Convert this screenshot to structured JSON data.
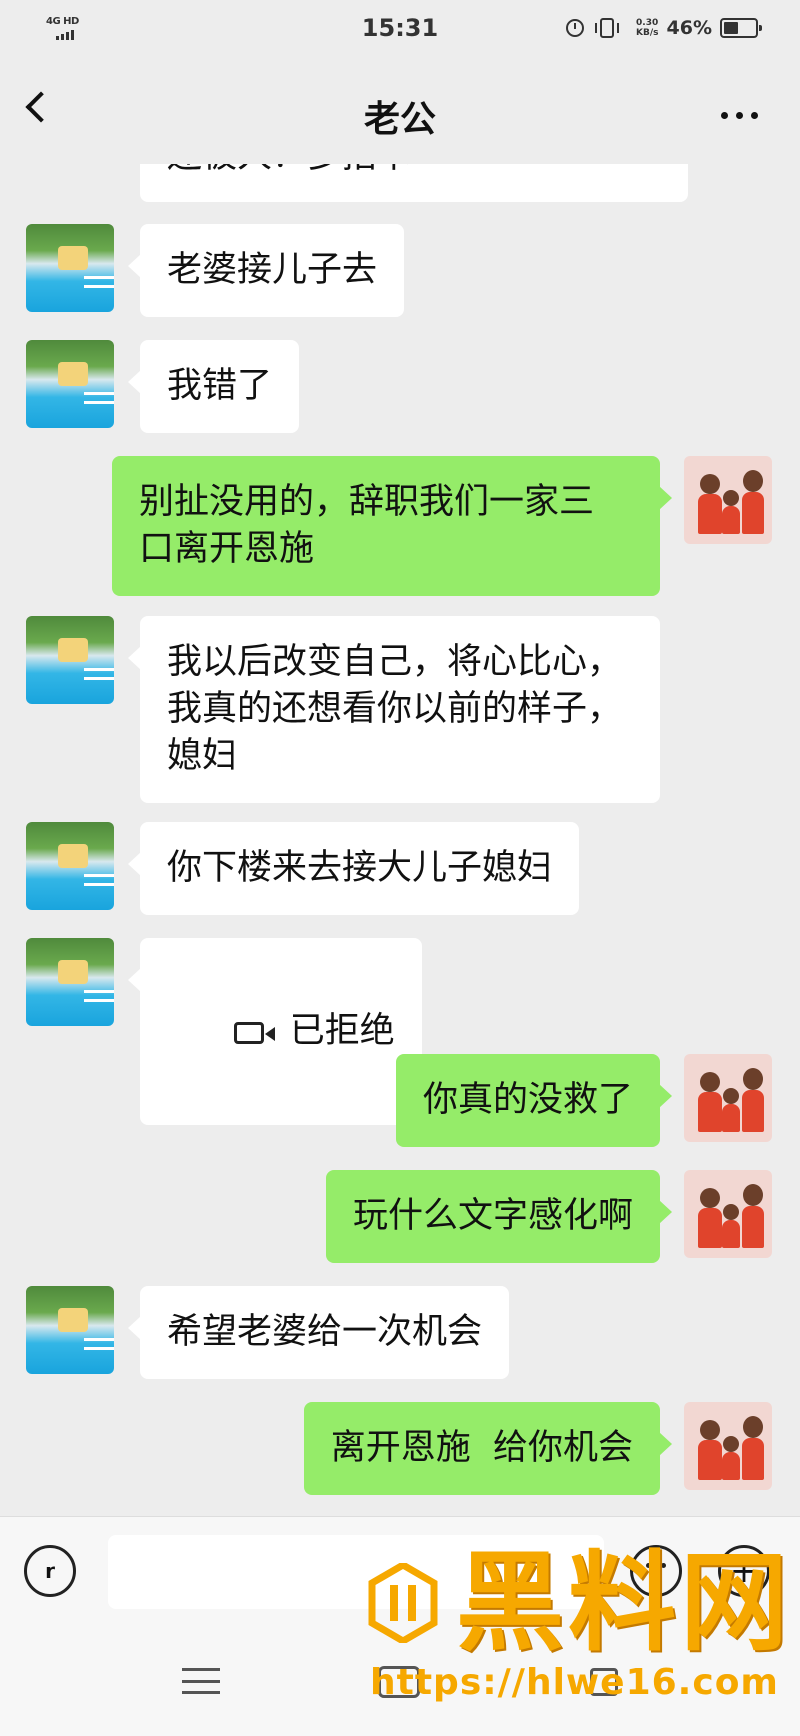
{
  "status_bar": {
    "network": "4G HD",
    "time": "15:31",
    "speed_value": "0.30",
    "speed_unit": "KB/s",
    "battery_percent": "46%",
    "battery_level": 0.46
  },
  "header": {
    "title": "老公",
    "back_icon": "chevron-left-icon",
    "more_icon": "more-dots-icon"
  },
  "messages": [
    {
      "side": "left",
      "text": "还被人？多招卡"
    },
    {
      "side": "left",
      "text": "老婆接儿子去"
    },
    {
      "side": "left",
      "text": "我错了"
    },
    {
      "side": "right",
      "text": "别扯没用的，辞职我们一家三\n口离开恩施"
    },
    {
      "side": "left",
      "text": "我以后改变自己，将心比心，\n我真的还想看你以前的样子，\n媳妇"
    },
    {
      "side": "left",
      "text": "你下楼来去接大儿子媳妇"
    },
    {
      "side": "left",
      "text": "已拒绝",
      "icon": "video-call-icon"
    },
    {
      "side": "right",
      "text": "你真的没救了"
    },
    {
      "side": "right",
      "text": "玩什么文字感化啊"
    },
    {
      "side": "left",
      "text": "希望老婆给一次机会"
    },
    {
      "side": "right",
      "text": "离开恩施  给你机会"
    }
  ],
  "input_bar": {
    "value": "",
    "voice_icon": "voice-icon",
    "emoji_icon": "emoji-icon",
    "plus_icon": "plus-icon"
  },
  "watermark": {
    "text": "黑料网",
    "url": "https://hlwe16.com"
  },
  "colors": {
    "background": "#ededed",
    "sent_bubble": "#95ec69",
    "received_bubble": "#ffffff",
    "watermark": "#f6a800"
  }
}
